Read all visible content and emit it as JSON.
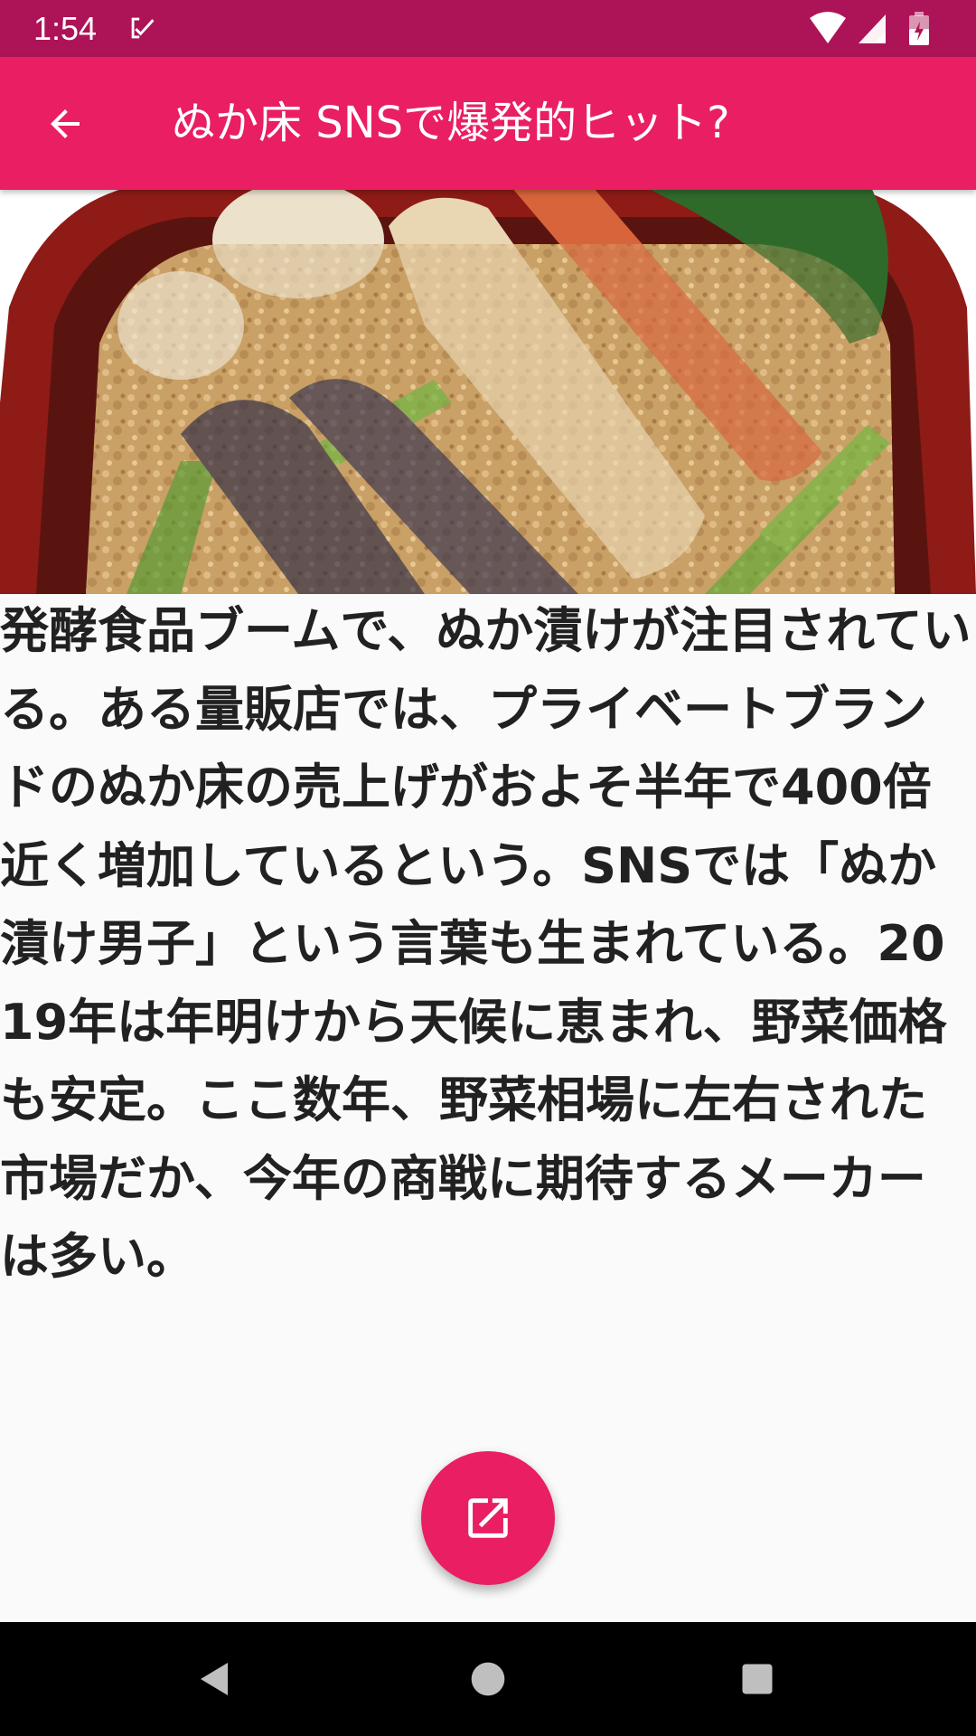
{
  "status_bar": {
    "time": "1:54",
    "notification_icon": "check-notification-icon",
    "wifi_icon": "wifi-icon",
    "signal_icon": "cell-signal-icon",
    "battery_icon": "battery-icon"
  },
  "app_bar": {
    "title": "ぬか床 SNSで爆発的ヒット?",
    "back_icon": "arrow-back-icon"
  },
  "article": {
    "image": "nukazuke-vegetables-in-pot",
    "body": "発酵食品ブームで、ぬか漬けが注目されている。ある量販店では、プライベートブランドのぬか床の売上げがおよそ半年で400倍近く増加しているという。SNSでは「ぬか漬け男子」という言葉も生まれている。2019年は年明けから天候に恵まれ、野菜価格も安定。ここ数年、野菜相場に左右された市場だか、今年の商戦に期待するメーカーは多い。"
  },
  "fab": {
    "icon": "open-in-new-icon"
  },
  "nav_bar": {
    "back_icon": "nav-back-icon",
    "home_icon": "nav-home-icon",
    "recents_icon": "nav-recents-icon"
  },
  "colors": {
    "status_bar": "#ad1457",
    "primary": "#e91e63",
    "background": "#fafafa",
    "text": "#212121"
  }
}
